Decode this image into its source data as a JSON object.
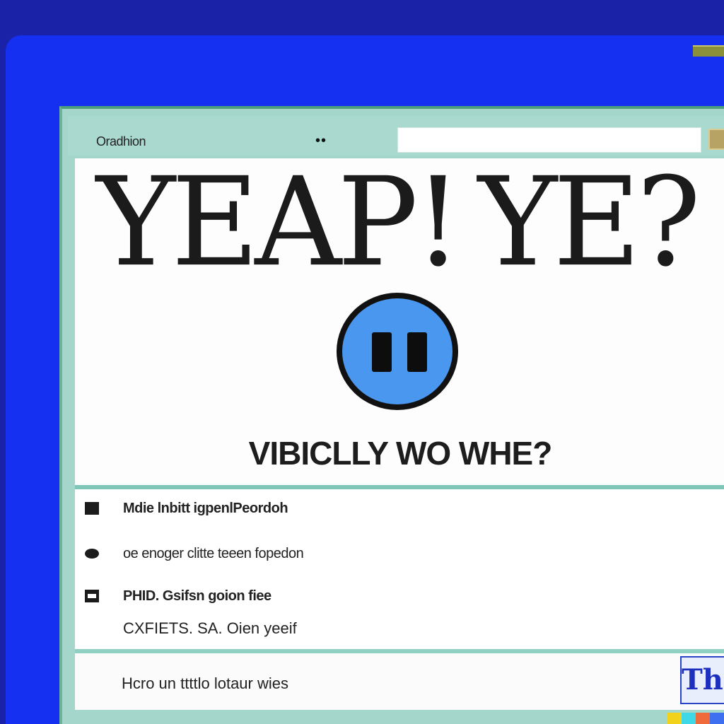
{
  "window": {
    "title": "Oradhion",
    "title_dots": "••",
    "address_value": ""
  },
  "hero": {
    "word_left": "YEAP!",
    "word_right": "YE?",
    "caption": "VIBICLLY WO WHE?"
  },
  "list": {
    "items": [
      {
        "icon": "square-icon",
        "label": "Mdie lnbitt igpenlPeordoh"
      },
      {
        "icon": "circle-icon",
        "label": "oe enoger clitte teeen fopedon"
      },
      {
        "icon": "window-icon",
        "label": "PHID. Gsifsn goion fiee",
        "sub": "CXFIETS. SA. Oien yeeif"
      }
    ]
  },
  "footer": {
    "text": "Hcro un ttttlo lotaur wies",
    "badge": "Thh"
  },
  "colors": {
    "desktop": "#1a22a8",
    "monitor": "#1630f2",
    "window_frame": "#a4d6cc",
    "chat_icon": "#4a97ef",
    "strip": [
      "#f2d21a",
      "#3fd8e8",
      "#ef6b3c",
      "#3d6ff0"
    ]
  }
}
